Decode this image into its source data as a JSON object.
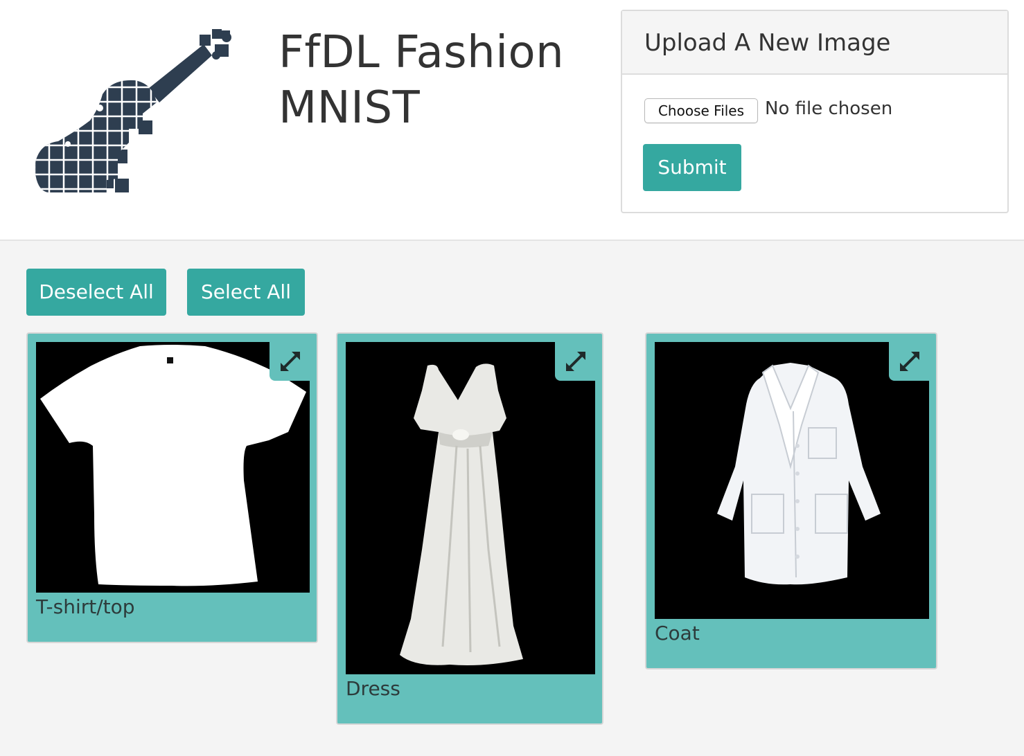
{
  "header": {
    "title": "FfDL Fashion MNIST",
    "logo_icon": "guitar-pixel-logo-icon"
  },
  "upload": {
    "heading": "Upload A New Image",
    "choose_label": "Choose Files",
    "file_status": "No file chosen",
    "submit_label": "Submit"
  },
  "actions": {
    "deselect_label": "Deselect All",
    "select_label": "Select All"
  },
  "gallery": {
    "items": [
      {
        "label": "T-shirt/top",
        "icon": "tshirt-image"
      },
      {
        "label": "Dress",
        "icon": "dress-image"
      },
      {
        "label": "Coat",
        "icon": "coat-image"
      }
    ],
    "expand_icon": "expand-icon"
  },
  "colors": {
    "accent": "#35a8a0",
    "card": "#64c0bb",
    "logo": "#2e3e50",
    "page_bg": "#f4f4f4"
  }
}
